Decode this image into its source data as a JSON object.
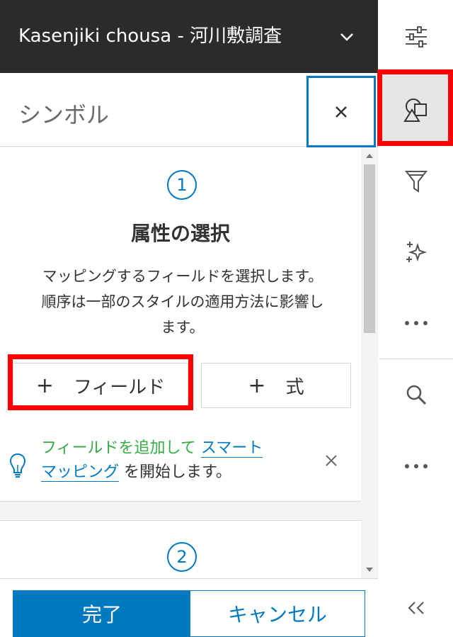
{
  "titlebar": {
    "title": "Kasenjiki chousa - 河川敷調査"
  },
  "header": {
    "label": "シンボル"
  },
  "step1": {
    "number": "1",
    "heading": "属性の選択",
    "desc_line1": "マッピングするフィールドを選択します。",
    "desc_line2": "順序は一部のスタイルの適用方法に影響し",
    "desc_line3": "ます。",
    "field_button": "フィールド",
    "expression_button": "式",
    "plus": "+"
  },
  "hint": {
    "part1": "フィールドを追加して",
    "link1": "スマート",
    "link2": "マッピング",
    "part2": "を開始します。"
  },
  "step2": {
    "number": "2"
  },
  "footer": {
    "done": "完了",
    "cancel": "キャンセル"
  },
  "colors": {
    "accent": "#0079c1",
    "titlebar": "#2b2b2b",
    "hint_green": "#35ac46",
    "highlight": "#ff0000"
  },
  "toolbar": {
    "icons": [
      "sliders-icon",
      "shapes-icon",
      "filter-icon",
      "sparkle-icon",
      "more-icon",
      "search-icon",
      "more-icon",
      "collapse-icon"
    ]
  }
}
